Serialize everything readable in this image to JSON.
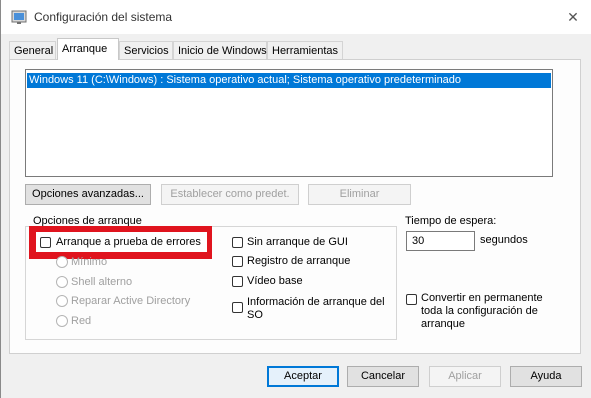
{
  "window": {
    "title": "Configuración del sistema",
    "close_glyph": "✕"
  },
  "tabs": [
    {
      "label": "General"
    },
    {
      "label": "Arranque"
    },
    {
      "label": "Servicios"
    },
    {
      "label": "Inicio de Windows"
    },
    {
      "label": "Herramientas"
    }
  ],
  "boot_list": {
    "selected_entry": "Windows 11 (C:\\Windows) : Sistema operativo actual; Sistema operativo predeterminado"
  },
  "list_buttons": {
    "advanced": "Opciones avanzadas...",
    "set_default": "Establecer como predet.",
    "delete": "Eliminar"
  },
  "boot_options": {
    "group_label": "Opciones de arranque",
    "safe_boot": "Arranque a prueba de errores",
    "minimal": "Mínimo",
    "alternate_shell": "Shell alterno",
    "repair_ad": "Reparar Active Directory",
    "network": "Red",
    "no_gui_boot": "Sin arranque de GUI",
    "boot_log": "Registro de arranque",
    "base_video": "Vídeo base",
    "os_boot_info": "Información de arranque del SO"
  },
  "timeout": {
    "label": "Tiempo de espera:",
    "value": "30",
    "unit": "segundos"
  },
  "make_permanent": "Convertir en permanente toda la configuración de arranque",
  "footer_buttons": {
    "ok": "Aceptar",
    "cancel": "Cancelar",
    "apply": "Aplicar",
    "help": "Ayuda"
  },
  "colors": {
    "selection": "#0078d7",
    "highlight_box": "#e0141e"
  },
  "icons": {
    "app": "msconfig-icon"
  }
}
